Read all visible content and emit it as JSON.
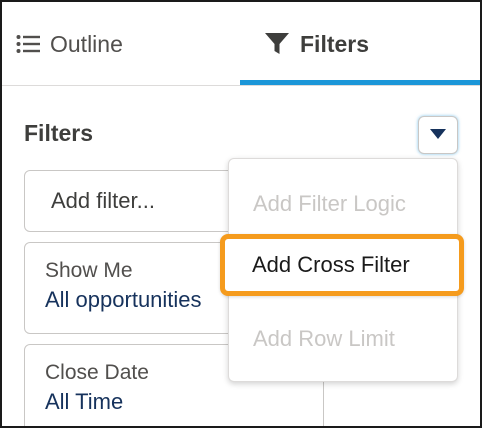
{
  "tabs": {
    "outline": {
      "label": "Outline",
      "icon": "list-icon"
    },
    "filters": {
      "label": "Filters",
      "icon": "funnel-icon",
      "active": true
    }
  },
  "panel": {
    "title": "Filters",
    "dropdown_icon": "triangle-down-icon"
  },
  "add_filter": {
    "placeholder": "Add filter..."
  },
  "filters": [
    {
      "label": "Show Me",
      "value": "All opportunities"
    },
    {
      "label": "Close Date",
      "value": "All Time"
    }
  ],
  "menu": {
    "items": [
      {
        "label": "Add Filter Logic",
        "disabled": true
      },
      {
        "label": "Add Cross Filter",
        "disabled": false,
        "highlighted": true
      },
      {
        "label": "Add Row Limit",
        "disabled": true
      }
    ]
  },
  "colors": {
    "accent": "#1b96d8",
    "highlight": "#f59b1d",
    "value_text": "#16325c",
    "disabled_text": "#c9c7c5"
  }
}
